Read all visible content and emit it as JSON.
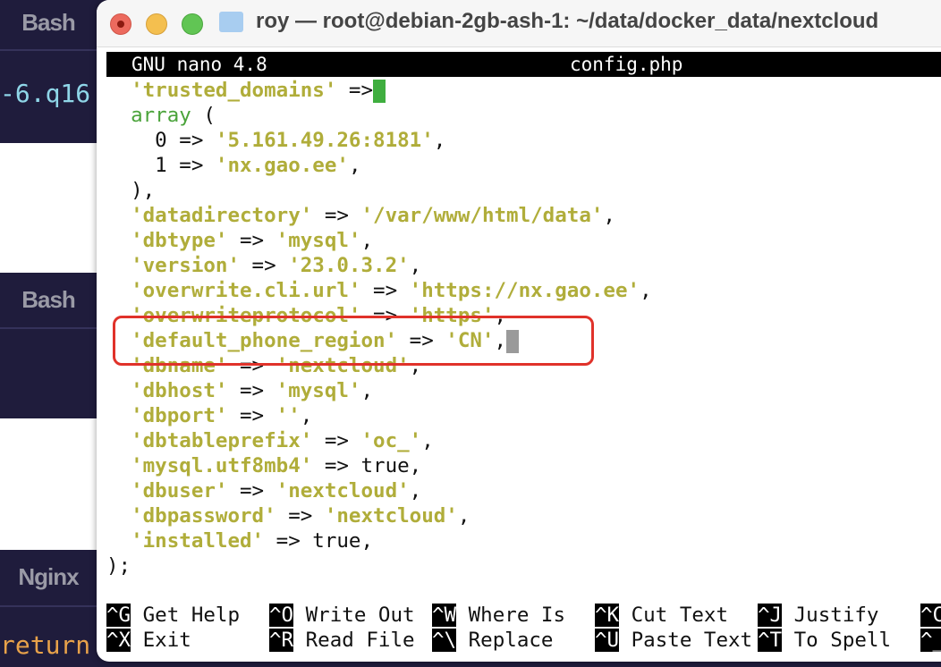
{
  "background": {
    "tabs": [
      "Bash",
      "Bash",
      "Nginx"
    ],
    "code_top": "-6.q16",
    "code_bottom": "return"
  },
  "window": {
    "title": "roy — root@debian-2gb-ash-1: ~/data/docker_data/nextcloud"
  },
  "nano": {
    "version": "GNU nano 4.8",
    "filename": "config.php"
  },
  "lines": [
    [
      [
        "k",
        "  'trusted_domains'"
      ],
      [
        "t",
        " =>"
      ],
      [
        "curg",
        ""
      ]
    ],
    [
      [
        "g",
        "  array"
      ],
      [
        "t",
        " ("
      ]
    ],
    [
      [
        "t",
        "    0 => "
      ],
      [
        "s",
        "'5.161.49.26:8181'"
      ],
      [
        "t",
        ","
      ]
    ],
    [
      [
        "t",
        "    1 => "
      ],
      [
        "s",
        "'nx.gao.ee'"
      ],
      [
        "t",
        ","
      ]
    ],
    [
      [
        "t",
        "  ),"
      ]
    ],
    [
      [
        "k",
        "  'datadirectory'"
      ],
      [
        "t",
        " => "
      ],
      [
        "s",
        "'/var/www/html/data'"
      ],
      [
        "t",
        ","
      ]
    ],
    [
      [
        "k",
        "  'dbtype'"
      ],
      [
        "t",
        " => "
      ],
      [
        "s",
        "'mysql'"
      ],
      [
        "t",
        ","
      ]
    ],
    [
      [
        "k",
        "  'version'"
      ],
      [
        "t",
        " => "
      ],
      [
        "s",
        "'23.0.3.2'"
      ],
      [
        "t",
        ","
      ]
    ],
    [
      [
        "k",
        "  'overwrite.cli.url'"
      ],
      [
        "t",
        " => "
      ],
      [
        "s",
        "'https://nx.gao.ee'"
      ],
      [
        "t",
        ","
      ]
    ],
    [
      [
        "k",
        "  'overwriteprotocol'"
      ],
      [
        "t",
        " => "
      ],
      [
        "s",
        "'https'"
      ],
      [
        "t",
        ","
      ]
    ],
    [
      [
        "k",
        "  'default_phone_region'"
      ],
      [
        "t",
        " => "
      ],
      [
        "s",
        "'CN'"
      ],
      [
        "t",
        ","
      ],
      [
        "curx",
        ""
      ]
    ],
    [
      [
        "k",
        "  'dbname'"
      ],
      [
        "t",
        " => "
      ],
      [
        "s",
        "'nextcloud'"
      ],
      [
        "t",
        ","
      ]
    ],
    [
      [
        "k",
        "  'dbhost'"
      ],
      [
        "t",
        " => "
      ],
      [
        "s",
        "'mysql'"
      ],
      [
        "t",
        ","
      ]
    ],
    [
      [
        "k",
        "  'dbport'"
      ],
      [
        "t",
        " => "
      ],
      [
        "s",
        "''"
      ],
      [
        "t",
        ","
      ]
    ],
    [
      [
        "k",
        "  'dbtableprefix'"
      ],
      [
        "t",
        " => "
      ],
      [
        "s",
        "'oc_'"
      ],
      [
        "t",
        ","
      ]
    ],
    [
      [
        "k",
        "  'mysql.utf8mb4'"
      ],
      [
        "t",
        " => true,"
      ]
    ],
    [
      [
        "k",
        "  'dbuser'"
      ],
      [
        "t",
        " => "
      ],
      [
        "s",
        "'nextcloud'"
      ],
      [
        "t",
        ","
      ]
    ],
    [
      [
        "k",
        "  'dbpassword'"
      ],
      [
        "t",
        " => "
      ],
      [
        "s",
        "'nextcloud'"
      ],
      [
        "t",
        ","
      ]
    ],
    [
      [
        "k",
        "  'installed'"
      ],
      [
        "t",
        " => true,"
      ]
    ],
    [
      [
        "t",
        ");"
      ]
    ]
  ],
  "shortcuts": [
    [
      {
        "key": "^G",
        "label": "Get Help"
      },
      {
        "key": "^O",
        "label": "Write Out"
      },
      {
        "key": "^W",
        "label": "Where Is"
      },
      {
        "key": "^K",
        "label": "Cut Text"
      },
      {
        "key": "^J",
        "label": "Justify"
      },
      {
        "key": "^C",
        "label": ""
      }
    ],
    [
      {
        "key": "^X",
        "label": "Exit"
      },
      {
        "key": "^R",
        "label": "Read File"
      },
      {
        "key": "^\\",
        "label": "Replace"
      },
      {
        "key": "^U",
        "label": "Paste Text"
      },
      {
        "key": "^T",
        "label": "To Spell"
      },
      {
        "key": "^_",
        "label": ""
      }
    ]
  ],
  "colors": {
    "string": "#b0ad3a",
    "keyword": "#4aa33a",
    "highlight_box": "#e0322a",
    "cursor_green": "#3fae3f",
    "cursor_gray": "#9a9a9a"
  }
}
